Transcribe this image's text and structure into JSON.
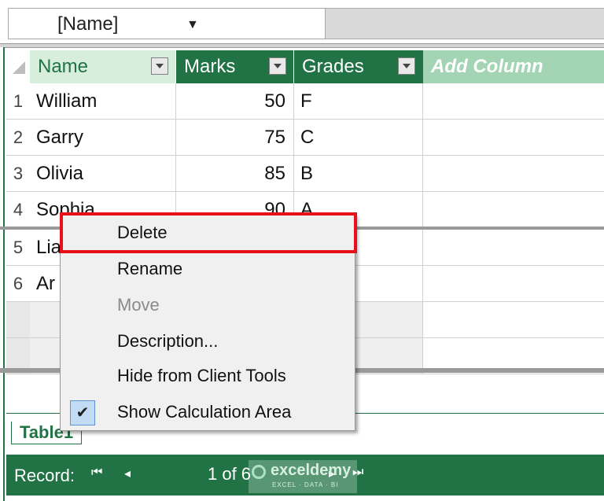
{
  "formula_bar": {
    "name_box": "[Name]"
  },
  "table": {
    "columns": [
      {
        "label": "Name"
      },
      {
        "label": "Marks"
      },
      {
        "label": "Grades"
      },
      {
        "label": "Add Column"
      }
    ],
    "rows": [
      {
        "num": "1",
        "name": "William",
        "marks": "50",
        "grade": "F"
      },
      {
        "num": "2",
        "name": "Garry",
        "marks": "75",
        "grade": "C"
      },
      {
        "num": "3",
        "name": "Olivia",
        "marks": "85",
        "grade": "B"
      },
      {
        "num": "4",
        "name": "Sophia",
        "marks": "90",
        "grade": "A"
      },
      {
        "num": "5",
        "name": "Lia",
        "marks": "",
        "grade": ""
      },
      {
        "num": "6",
        "name": "Ar",
        "marks": "",
        "grade": ""
      }
    ]
  },
  "context_menu": {
    "items": [
      {
        "label": "Delete",
        "enabled": true,
        "highlighted": true
      },
      {
        "label": "Rename",
        "enabled": true
      },
      {
        "label": "Move",
        "enabled": false
      },
      {
        "label": "Description...",
        "enabled": true
      },
      {
        "label": "Hide from Client Tools",
        "enabled": true
      },
      {
        "label": "Show Calculation Area",
        "enabled": true,
        "checked": true
      }
    ]
  },
  "sheet_tab": "Table1",
  "status_bar": {
    "record_label": "Record:",
    "page": "1 of 6",
    "nav_first": "⏮",
    "nav_prev": "◂",
    "nav_next": "▸",
    "nav_last": "⏭"
  },
  "watermark": {
    "name": "exceldemy",
    "tagline": "EXCEL · DATA · BI"
  },
  "colors": {
    "accent": "#217346",
    "highlight_border": "#e8101a"
  }
}
